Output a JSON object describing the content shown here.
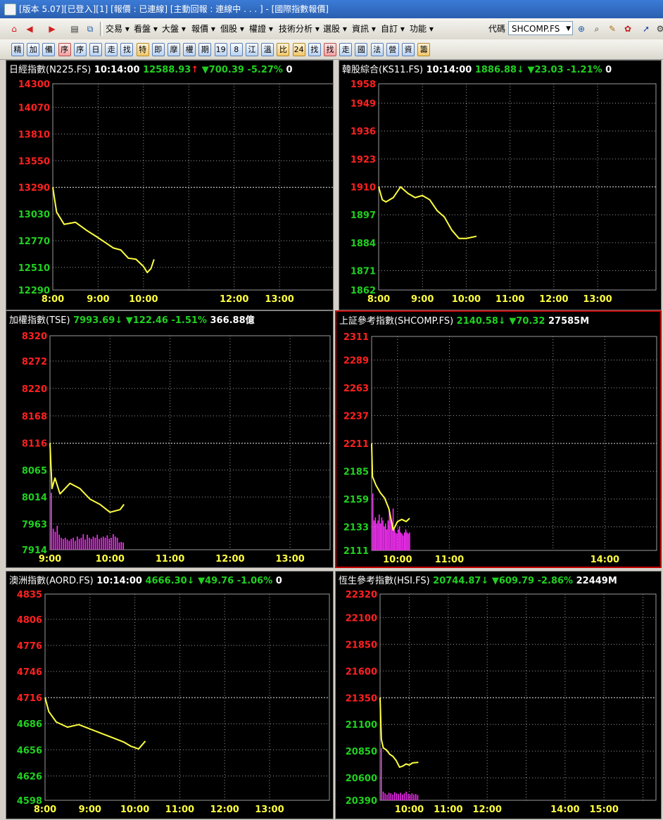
{
  "window": {
    "title": "[版本 5.07][已登入][1] [報價 : 已連線] [主動回報 : 連線中 . . . ] - [國際指數報價]"
  },
  "toolbar": {
    "menus": [
      "交易",
      "看盤",
      "大盤",
      "報價",
      "個股",
      "權證",
      "技術分析",
      "選股",
      "資訊",
      "自訂",
      "功能"
    ],
    "code_label": "代碼",
    "code_value": "SHCOMP.FS"
  },
  "quick_tabs": [
    "精",
    "加",
    "備",
    "序",
    "序",
    "日",
    "走",
    "找",
    "特",
    "即",
    "摩",
    "權",
    "期",
    "19",
    "8",
    "江",
    "溫",
    "比",
    "24",
    "找",
    "找",
    "走",
    "國",
    "法",
    "營",
    "資",
    "籌"
  ],
  "colors": {
    "up": "#ff2020",
    "down": "#20d020",
    "price_line": "#ffff40",
    "volume": "#ff30ff",
    "grid": "#9a9a9a",
    "axis_red": "#ff2020",
    "axis_green": "#20d020",
    "time_label": "#ffff40",
    "active_border": "#c00000"
  },
  "panels": [
    {
      "name": "日經指數(N225.FS)",
      "time": "10:14:00",
      "price": "12588.93",
      "arrow": "up",
      "change": "700.39",
      "pct": "-5.27%",
      "volume": "0",
      "y_ticks": [
        14300,
        14070,
        13810,
        13550,
        13290,
        13030,
        12770,
        12510,
        12290
      ],
      "ref": 13290,
      "x_labels": [
        "8:00",
        "9:00",
        "10:00",
        "12:00",
        "13:00"
      ],
      "x_range": [
        "8:00",
        "14:20"
      ],
      "x_tick_values": [
        "8:00",
        "9:00",
        "10:00",
        "11:00",
        "12:00",
        "13:00"
      ],
      "chart_data": {
        "type": "line",
        "x": [
          "8:00",
          "8:05",
          "8:15",
          "8:30",
          "8:45",
          "9:00",
          "9:10",
          "9:20",
          "9:30",
          "9:40",
          "9:50",
          "10:00",
          "10:05",
          "10:10",
          "10:14"
        ],
        "values": [
          13290,
          13050,
          12930,
          12950,
          12870,
          12800,
          12750,
          12700,
          12680,
          12600,
          12590,
          12520,
          12460,
          12500,
          12589
        ],
        "ylim": [
          12290,
          14300
        ]
      },
      "volume_bars": null
    },
    {
      "name": "韓股綜合(KS11.FS)",
      "time": "10:14:00",
      "price": "1886.88",
      "arrow": "down",
      "change": "23.03",
      "pct": "-1.21%",
      "volume": "0",
      "y_ticks": [
        1958,
        1949,
        1936,
        1923,
        1910,
        1897,
        1884,
        1871,
        1862
      ],
      "ref": 1910,
      "x_labels": [
        "8:00",
        "9:00",
        "10:00",
        "11:00",
        "12:00",
        "13:00"
      ],
      "x_range": [
        "8:00",
        "14:20"
      ],
      "x_tick_values": [
        "8:00",
        "9:00",
        "10:00",
        "11:00",
        "12:00",
        "13:00"
      ],
      "chart_data": {
        "type": "line",
        "x": [
          "8:00",
          "8:05",
          "8:10",
          "8:20",
          "8:30",
          "8:40",
          "8:50",
          "9:00",
          "9:10",
          "9:20",
          "9:30",
          "9:40",
          "9:50",
          "10:00",
          "10:14"
        ],
        "values": [
          1910,
          1904,
          1903,
          1905,
          1910,
          1907,
          1905,
          1906,
          1904,
          1899,
          1896,
          1890,
          1886,
          1886,
          1887
        ],
        "ylim": [
          1862,
          1958
        ]
      },
      "volume_bars": null
    },
    {
      "name": "加權指數(TSE)",
      "time": "",
      "price": "7993.69",
      "arrow": "down",
      "change": "122.46",
      "pct": "-1.51%",
      "volume": "366.88億",
      "y_ticks": [
        8320,
        8272,
        8220,
        8168,
        8116,
        8065,
        8014,
        7963,
        7914
      ],
      "ref": 8116,
      "x_labels": [
        "9:00",
        "10:00",
        "11:00",
        "12:00",
        "13:00"
      ],
      "x_range": [
        "9:00",
        "13:40"
      ],
      "x_tick_values": [
        "9:00",
        "10:00",
        "11:00",
        "12:00",
        "13:00"
      ],
      "chart_data": {
        "type": "line",
        "x": [
          "9:00",
          "9:02",
          "9:05",
          "9:10",
          "9:20",
          "9:30",
          "9:40",
          "9:50",
          "10:00",
          "10:10",
          "10:14"
        ],
        "values": [
          8116,
          8030,
          8050,
          8020,
          8040,
          8030,
          8010,
          8000,
          7985,
          7990,
          8000
        ],
        "ylim": [
          7914,
          8320
        ]
      },
      "volume_bars": {
        "max": 1.0,
        "values": [
          0.95,
          0.35,
          0.3,
          0.4,
          0.25,
          0.2,
          0.18,
          0.2,
          0.17,
          0.15,
          0.18,
          0.2,
          0.15,
          0.22,
          0.18,
          0.2,
          0.26,
          0.17,
          0.25,
          0.2,
          0.18,
          0.22,
          0.2,
          0.25,
          0.18,
          0.2,
          0.22,
          0.2,
          0.24,
          0.18,
          0.2,
          0.26,
          0.22,
          0.2,
          0.12,
          0.13,
          0.12
        ]
      }
    },
    {
      "name": "上証參考指數(SHCOMP.FS)",
      "time": "",
      "price": "2140.58",
      "arrow": "down",
      "change": "70.32",
      "pct": "",
      "volume": "27585M",
      "y_ticks": [
        2311,
        2289,
        2263,
        2237,
        2211,
        2185,
        2159,
        2133,
        2111
      ],
      "ref": 2211,
      "x_labels": [
        "10:00",
        "11:00",
        "14:00"
      ],
      "x_range": [
        "9:30",
        "15:00"
      ],
      "x_tick_values": [
        "10:00",
        "11:00",
        "13:00",
        "14:00"
      ],
      "chart_data": {
        "type": "line",
        "x": [
          "9:30",
          "9:31",
          "9:35",
          "9:40",
          "9:45",
          "9:50",
          "9:55",
          "10:00",
          "10:05",
          "10:10",
          "10:14"
        ],
        "values": [
          2211,
          2180,
          2172,
          2165,
          2160,
          2150,
          2130,
          2138,
          2140,
          2138,
          2141
        ],
        "ylim": [
          2111,
          2311
        ]
      },
      "volume_bars": {
        "max": 1.0,
        "values": [
          0.95,
          0.5,
          0.55,
          0.45,
          0.5,
          0.6,
          0.45,
          0.55,
          0.5,
          0.4,
          0.45,
          0.35,
          0.5,
          0.65,
          0.55,
          0.45,
          0.7,
          0.35,
          0.3,
          0.28,
          0.35,
          0.4,
          0.3,
          0.28,
          0.25,
          0.3,
          0.35,
          0.3,
          0.28,
          0.3
        ]
      }
    },
    {
      "name": "澳洲指數(AORD.FS)",
      "time": "10:14:00",
      "price": "4666.30",
      "arrow": "down",
      "change": "49.76",
      "pct": "-1.06%",
      "volume": "0",
      "y_ticks": [
        4835,
        4806,
        4776,
        4746,
        4716,
        4686,
        4656,
        4626,
        4598
      ],
      "ref": 4716,
      "x_labels": [
        "8:00",
        "9:00",
        "10:00",
        "11:00",
        "12:00",
        "13:00"
      ],
      "x_range": [
        "8:00",
        "14:20"
      ],
      "x_tick_values": [
        "8:00",
        "9:00",
        "10:00",
        "11:00",
        "12:00",
        "13:00"
      ],
      "chart_data": {
        "type": "line",
        "x": [
          "8:00",
          "8:05",
          "8:15",
          "8:30",
          "8:45",
          "9:00",
          "9:15",
          "9:30",
          "9:45",
          "9:55",
          "10:05",
          "10:14"
        ],
        "values": [
          4716,
          4700,
          4688,
          4682,
          4685,
          4680,
          4675,
          4670,
          4665,
          4660,
          4657,
          4666
        ],
        "ylim": [
          4598,
          4835
        ]
      },
      "volume_bars": null
    },
    {
      "name": "恆生參考指數(HSI.FS)",
      "time": "",
      "price": "20744.87",
      "arrow": "down",
      "change": "609.79",
      "pct": "-2.86%",
      "volume": "22449M",
      "y_ticks": [
        22320,
        22100,
        21850,
        21600,
        21350,
        21100,
        20850,
        20600,
        20390
      ],
      "ref": 21350,
      "x_labels": [
        "10:00",
        "11:00",
        "12:00",
        "14:00",
        "15:00"
      ],
      "x_range": [
        "9:15",
        "16:20"
      ],
      "x_tick_values": [
        "10:00",
        "11:00",
        "12:00",
        "13:00",
        "14:00",
        "15:00",
        "16:00"
      ],
      "chart_data": {
        "type": "line",
        "x": [
          "9:15",
          "9:17",
          "9:20",
          "9:25",
          "9:30",
          "9:35",
          "9:40",
          "9:45",
          "9:50",
          "9:55",
          "10:00",
          "10:05",
          "10:14"
        ],
        "values": [
          21350,
          20960,
          20880,
          20860,
          20820,
          20800,
          20760,
          20700,
          20710,
          20730,
          20720,
          20740,
          20745
        ],
        "ylim": [
          20390,
          22320
        ]
      },
      "volume_bars": {
        "max": 1.0,
        "values": [
          0.9,
          0.15,
          0.12,
          0.1,
          0.13,
          0.12,
          0.1,
          0.14,
          0.12,
          0.11,
          0.13,
          0.1,
          0.12,
          0.15,
          0.11,
          0.1,
          0.12,
          0.1,
          0.11,
          0.09
        ]
      }
    }
  ]
}
